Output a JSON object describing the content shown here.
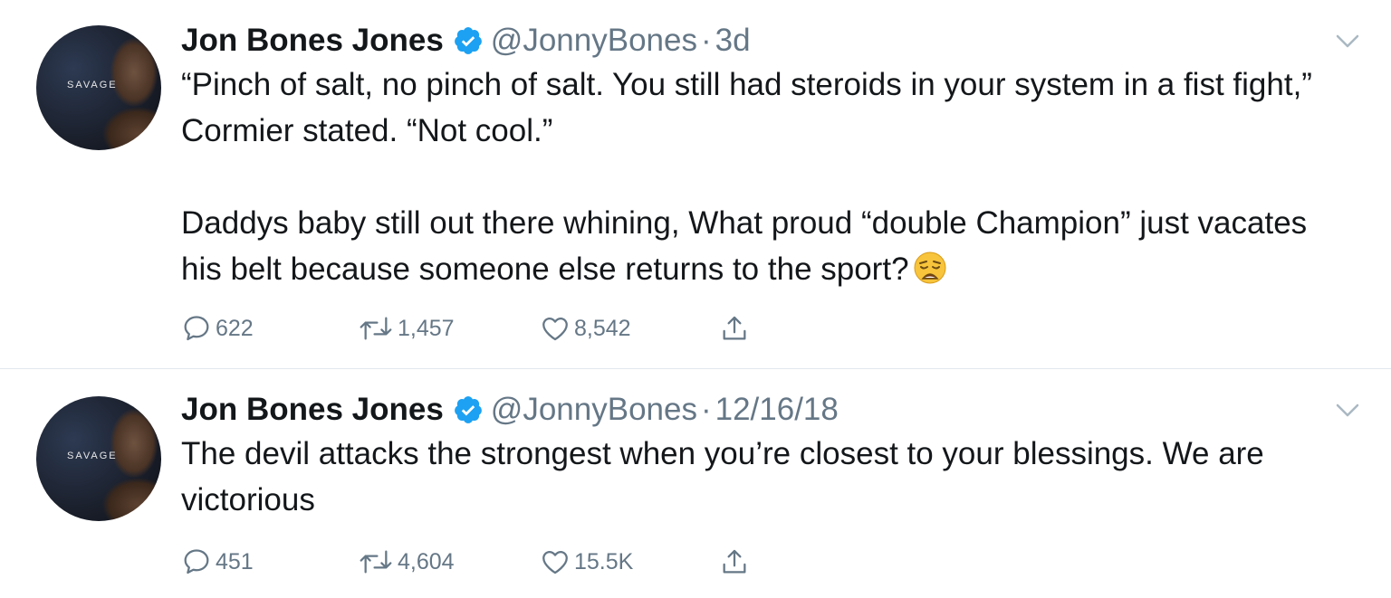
{
  "tweets": [
    {
      "author_name": "Jon Bones Jones",
      "handle": "@JonnyBones",
      "separator": "·",
      "time": "3d",
      "avatar_text": "SAVAGE",
      "text": "“Pinch of salt, no pinch of salt. You still had steroids in your system in a fist fight,” Cormier stated. “Not cool.”\n\nDaddys baby still out there whining, What proud “double Champion” just vacates his belt because someone else returns to the sport?",
      "emoji": "weary-face-emoji",
      "replies": "622",
      "retweets": "1,457",
      "likes": "8,542"
    },
    {
      "author_name": "Jon Bones Jones",
      "handle": "@JonnyBones",
      "separator": "·",
      "time": "12/16/18",
      "avatar_text": "SAVAGE",
      "text": "The devil attacks the strongest when you’re closest to your blessings. We are victorious",
      "replies": "451",
      "retweets": "4,604",
      "likes": "15.5K"
    }
  ],
  "icons": {
    "verified": "verified-badge-icon",
    "caret": "chevron-down-icon",
    "reply": "reply-icon",
    "retweet": "retweet-icon",
    "like": "heart-icon",
    "share": "share-icon"
  },
  "colors": {
    "verified_blue": "#1da1f2",
    "text_primary": "#14171a",
    "text_secondary": "#657786",
    "divider": "#e1e8ed"
  }
}
